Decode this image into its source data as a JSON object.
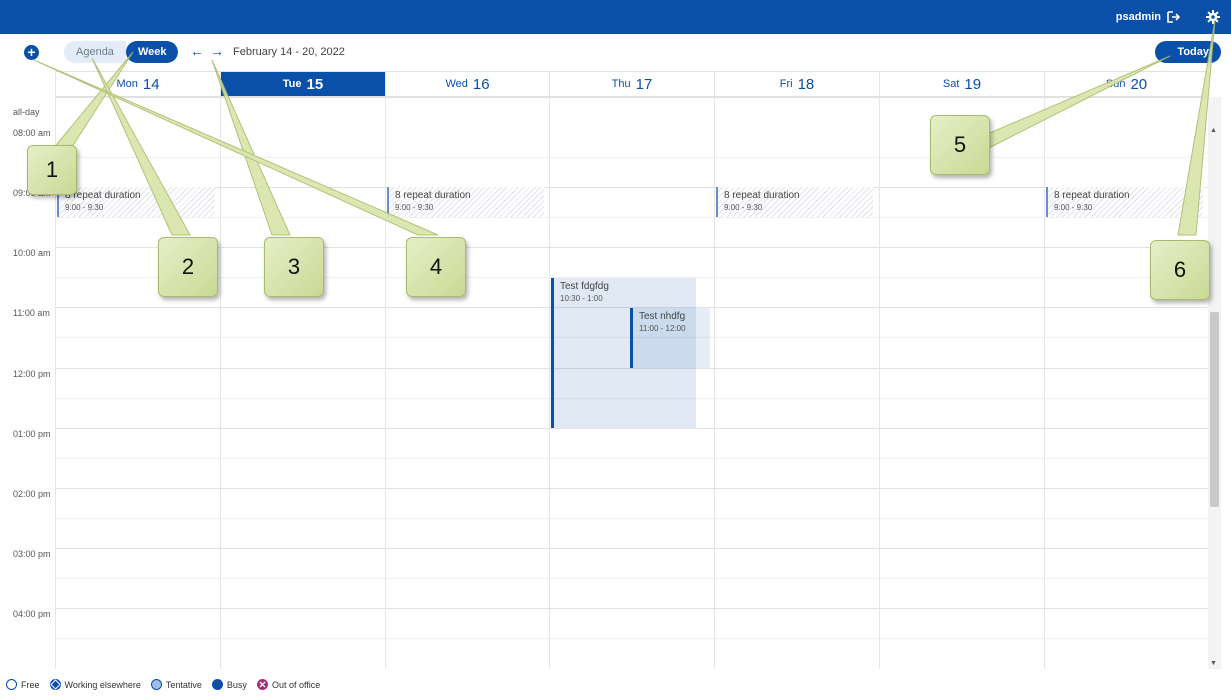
{
  "topbar": {
    "username": "psadmin"
  },
  "toolbar": {
    "add_label": "+",
    "views": {
      "agenda": "Agenda",
      "week": "Week"
    },
    "date_range": "February 14 - 20, 2022",
    "today": "Today"
  },
  "days": [
    {
      "name": "Mon",
      "num": "14"
    },
    {
      "name": "Tue",
      "num": "15"
    },
    {
      "name": "Wed",
      "num": "16"
    },
    {
      "name": "Thu",
      "num": "17"
    },
    {
      "name": "Fri",
      "num": "18"
    },
    {
      "name": "Sat",
      "num": "19"
    },
    {
      "name": "Sun",
      "num": "20"
    }
  ],
  "allday_label": "all-day",
  "times": [
    "08:00 am",
    "09:00 am",
    "10:00 am",
    "11:00 am",
    "12:00 pm",
    "01:00 pm",
    "02:00 pm",
    "03:00 pm",
    "04:00 pm"
  ],
  "events": {
    "repeat_title": "8 repeat duration",
    "repeat_time": "9:00 - 9:30",
    "test1_title": "Test fdgfdg",
    "test1_time": "10:30 - 1:00",
    "test2_title": "Test nhdfg",
    "test2_time": "11:00 - 12:00"
  },
  "legend": {
    "free": "Free",
    "working_elsewhere": "Working elsewhere",
    "tentative": "Tentative",
    "busy": "Busy",
    "out_of_office": "Out of office"
  },
  "callouts": [
    "1",
    "2",
    "3",
    "4",
    "5",
    "6"
  ],
  "colors": {
    "primary": "#0a4fa8",
    "callout": "#c9d994",
    "out_of_office": "#a0307a"
  }
}
